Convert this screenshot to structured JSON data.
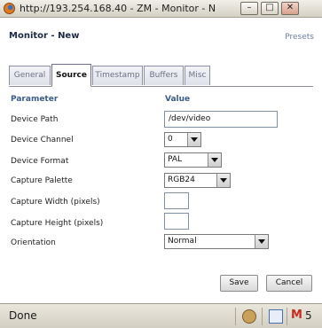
{
  "window": {
    "title": "http://193.254.168.40 - ZM - Monitor - N",
    "minimize_label": "–",
    "maximize_label": "□",
    "close_label": "✕"
  },
  "header": {
    "title": "Monitor - New",
    "presets_label": "Presets"
  },
  "tabs": [
    {
      "label": "General",
      "active": false
    },
    {
      "label": "Source",
      "active": true
    },
    {
      "label": "Timestamp",
      "active": false
    },
    {
      "label": "Buffers",
      "active": false
    },
    {
      "label": "Misc",
      "active": false
    }
  ],
  "table": {
    "header_parameter": "Parameter",
    "header_value": "Value",
    "rows": [
      {
        "label": "Device Path",
        "type": "text",
        "value": "/dev/video"
      },
      {
        "label": "Device Channel",
        "type": "select",
        "value": "0"
      },
      {
        "label": "Device Format",
        "type": "select",
        "value": "PAL"
      },
      {
        "label": "Capture Palette",
        "type": "select",
        "value": "RGB24"
      },
      {
        "label": "Capture Width (pixels)",
        "type": "text",
        "value": ""
      },
      {
        "label": "Capture Height (pixels)",
        "type": "text",
        "value": ""
      },
      {
        "label": "Orientation",
        "type": "select",
        "value": "Normal"
      }
    ]
  },
  "buttons": {
    "save_label": "Save",
    "cancel_label": "Cancel"
  },
  "statusbar": {
    "status_text": "Done",
    "gmail_glyph": "M",
    "gmail_count": "5"
  },
  "icons": {
    "browser": "firefox-icon",
    "status_1": "cookie-icon",
    "status_2": "screen-icon",
    "status_3": "gmail-icon"
  }
}
